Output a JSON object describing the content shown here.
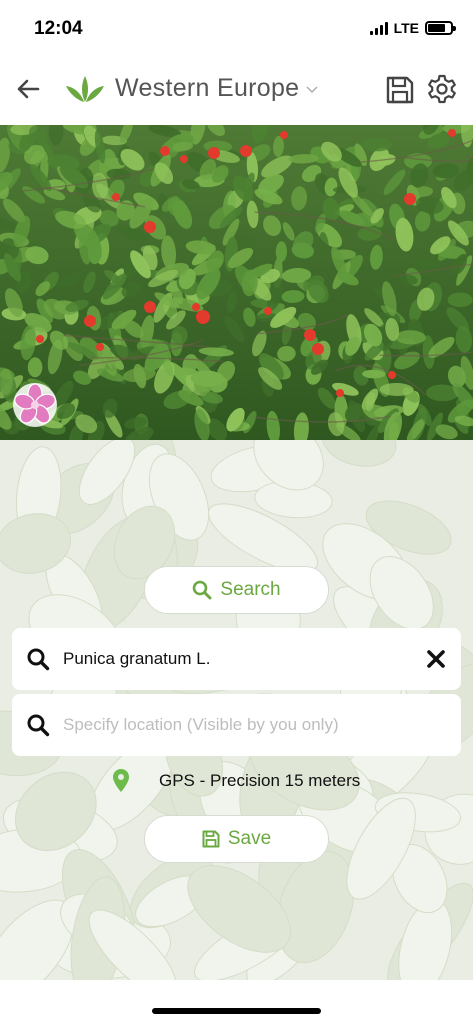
{
  "status_bar": {
    "time": "12:04",
    "network": "LTE",
    "battery_level": 0.75
  },
  "header": {
    "title": "Western Europe",
    "back_icon": "arrow-left-icon",
    "logo_icon": "leaf-logo-icon",
    "dropdown_icon": "chevron-down-icon",
    "save_icon": "floppy-disk-icon",
    "settings_icon": "gear-icon"
  },
  "photo": {
    "badge_icon": "flower-icon"
  },
  "actions": {
    "search_label": "Search",
    "save_label": "Save"
  },
  "form": {
    "species_value": "Punica granatum L.",
    "location_placeholder": "Specify location (Visible by you only)",
    "gps_text": "GPS - Precision 15 meters"
  },
  "colors": {
    "accent_green": "#6aa842",
    "pin_green": "#6dbb4a",
    "panel_bg": "#e9ede4",
    "badge_pink": "#e27bbf"
  }
}
